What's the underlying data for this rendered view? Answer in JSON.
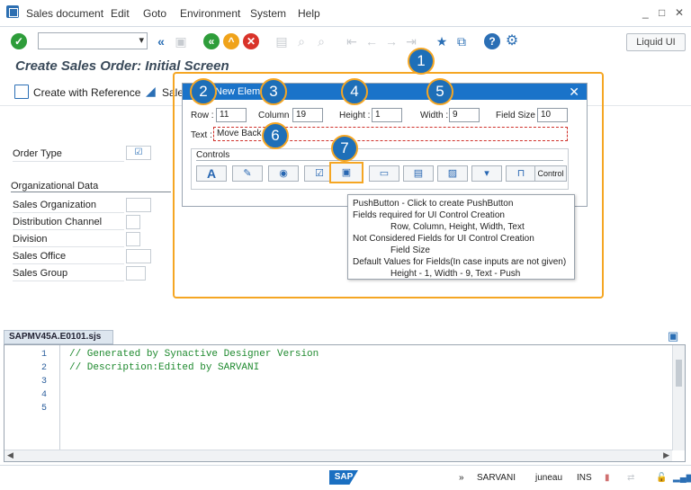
{
  "menubar": {
    "items": [
      "Sales document",
      "Edit",
      "Goto",
      "Environment",
      "System",
      "Help"
    ],
    "window_controls": [
      "_",
      "□",
      "✕"
    ]
  },
  "toolbar": {
    "command_value": "",
    "liquid_ui_label": "Liquid UI"
  },
  "screen": {
    "title": "Create Sales Order: Initial Screen"
  },
  "appbar": {
    "create_with_reference": "Create with Reference",
    "sales_label": "Sale"
  },
  "form": {
    "order_type_label": "Order Type",
    "org_section": "Organizational Data",
    "sales_org_label": "Sales Organization",
    "dist_channel_label": "Distribution Channel",
    "division_label": "Division",
    "sales_office_label": "Sales Office",
    "sales_group_label": "Sales Group"
  },
  "dialog": {
    "title": "New Element",
    "row_label": "Row :",
    "row_value": "11",
    "column_label": "Column :",
    "column_value": "19",
    "height_label": "Height :",
    "height_value": "1",
    "width_label": "Width :",
    "width_value": "9",
    "fieldsize_label": "Field Size :",
    "fieldsize_value": "10",
    "text_label": "Text :",
    "text_value": "Move Back",
    "controls_label": "Controls",
    "control_button_label": "Control"
  },
  "tooltip": {
    "lines": [
      "PushButton - Click to create PushButton",
      "Fields required for UI Control Creation",
      "Row, Column, Height, Width, Text",
      "Not Considered Fields for UI Control Creation",
      "Field Size",
      "Default Values for Fields(In case inputs are not given)",
      "Height - 1, Width - 9, Text - Push"
    ]
  },
  "badges": [
    "1",
    "2",
    "3",
    "4",
    "5",
    "6",
    "7"
  ],
  "editor": {
    "tab_label": "SAPMV45A.E0101.sjs",
    "line_numbers": [
      "1",
      "2",
      "3",
      "4",
      "5"
    ],
    "code_lines": [
      "// Generated by Synactive Designer Version",
      "// Description:Edited by SARVANI"
    ]
  },
  "statusbar": {
    "chevrons": "»",
    "user": "SARVANI",
    "server": "juneau",
    "mode": "INS",
    "sap_logo": "SAP"
  },
  "colors": {
    "accent": "#1e6fb8",
    "highlight": "#f5a623",
    "dialog_header": "#1a73c9",
    "code_green": "#1f8a2f"
  }
}
